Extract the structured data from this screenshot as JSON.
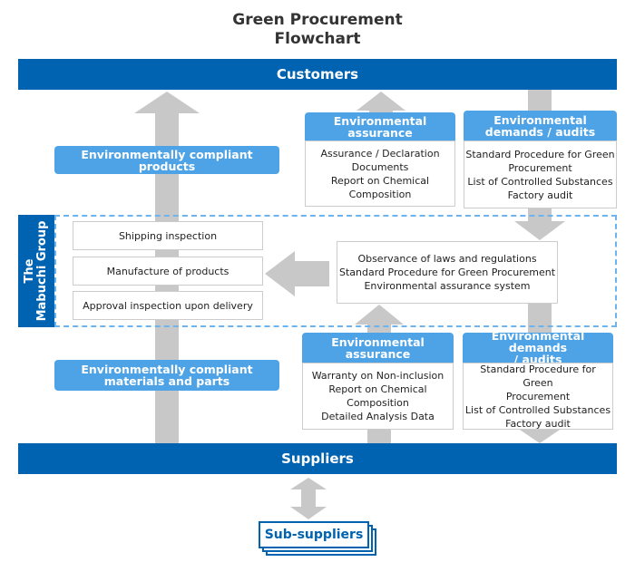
{
  "title_lines": [
    "Green Procurement",
    "Flowchart"
  ],
  "customers": "Customers",
  "suppliers": "Suppliers",
  "sub_suppliers": "Sub-suppliers",
  "group_label_lines": [
    "The",
    "Mabuchi Group"
  ],
  "left": {
    "products": "Environmentally compliant products",
    "materials_lines": [
      "Environmentally compliant",
      "materials and parts"
    ]
  },
  "process": [
    "Shipping inspection",
    "Manufacture of products",
    "Approval inspection upon delivery"
  ],
  "observance": [
    "Observance of laws and regulations",
    "Standard Procedure for Green Procurement",
    "Environmental assurance system"
  ],
  "top_assurance": {
    "label": "Environmental assurance",
    "items": [
      "Assurance / Declaration",
      "Documents",
      "Report on Chemical Composition"
    ]
  },
  "top_demands": {
    "label_lines": [
      "Environmental",
      "demands / audits"
    ],
    "items": [
      "Standard Procedure for Green",
      "Procurement",
      "List of Controlled Substances",
      "Factory audit"
    ]
  },
  "bottom_assurance": {
    "label_lines": [
      "Environmental",
      "assurance"
    ],
    "items": [
      "Warranty on Non-inclusion",
      "Report on Chemical Composition",
      "Detailed Analysis Data"
    ]
  },
  "bottom_demands": {
    "label_lines": [
      "Environmental demands",
      "/ audits"
    ],
    "items": [
      "Standard Procedure for Green",
      "Procurement",
      "List of Controlled Substances",
      "Factory audit"
    ]
  },
  "colors": {
    "dark_blue": "#0063b1",
    "light_blue": "#4ea3e6",
    "arrow_gray": "#c8c8c8",
    "dashed": "#6db3ee"
  }
}
